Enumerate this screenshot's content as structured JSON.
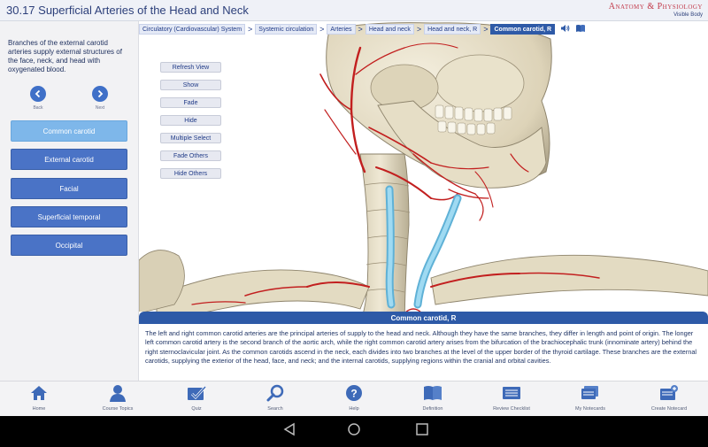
{
  "header": {
    "title": "30.17 Superficial Arteries of the Head and Neck",
    "brand": "Anatomy & Physiology",
    "brand_sub": "Visible Body"
  },
  "left_panel": {
    "description": "Branches of the external carotid arteries supply external structures of the face, neck, and head with oxygenated blood.",
    "back_label": "Back",
    "next_label": "Next",
    "arteries": [
      "Common carotid",
      "External carotid",
      "Facial",
      "Superficial temporal",
      "Occipital"
    ],
    "active_index": 0
  },
  "breadcrumbs": [
    "Circulatory (Cardiovascular) System",
    "Systemic circulation",
    "Arteries",
    "Head and neck",
    "Head and neck, R"
  ],
  "breadcrumb_current": "Common carotid, R",
  "tools": [
    "Refresh View",
    "Show",
    "Fade",
    "Hide",
    "Multiple Select",
    "Fade Others",
    "Hide Others"
  ],
  "info": {
    "title": "Common carotid, R",
    "text": "The left and right common carotid arteries are the principal arteries of supply to the head and neck. Although they have the same branches, they differ in length and point of origin. The longer left common carotid artery is the second branch of the aortic arch, while the right common carotid artery arises from the bifurcation of the brachiocephalic trunk (innominate artery) behind the right sternoclavicular joint. As the common carotids ascend in the neck, each divides into two branches at the level of the upper border of the thyroid cartilage. These branches are the external carotids, supplying the exterior of the head, face, and neck; and the internal carotids, supplying regions within the cranial and orbital cavities."
  },
  "bottom_nav": [
    {
      "label": "Home",
      "icon": "home-icon"
    },
    {
      "label": "Course Topics",
      "icon": "person-icon"
    },
    {
      "label": "Quiz",
      "icon": "quiz-check-icon"
    },
    {
      "label": "Search",
      "icon": "search-icon"
    },
    {
      "label": "Help",
      "icon": "help-icon"
    },
    {
      "label": "Definition",
      "icon": "book-icon"
    },
    {
      "label": "Review Checklist",
      "icon": "checklist-icon"
    },
    {
      "label": "My Notecards",
      "icon": "notecards-icon"
    },
    {
      "label": "Create Notecard",
      "icon": "create-notecard-icon"
    }
  ],
  "colors": {
    "accent": "#2e5aa7",
    "button": "#4a73c6",
    "active_button": "#7eb7ea",
    "artery_red": "#c21f1f",
    "carotid_highlight": "#8fd3f0",
    "bone": "#e8e1cc"
  }
}
